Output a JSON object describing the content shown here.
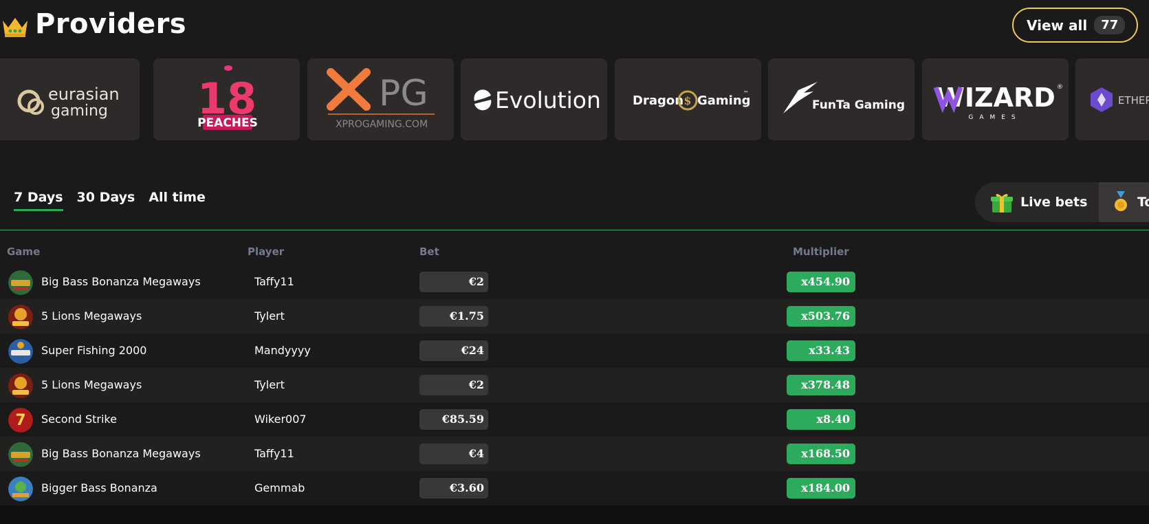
{
  "header": {
    "title": "Providers",
    "view_all_label": "View all",
    "view_all_count": "77",
    "crown_icon": "crown-icon"
  },
  "providers": [
    {
      "name": "eurasian gaming",
      "line1": "eurasian",
      "line2": "gaming"
    },
    {
      "name": "18 Peaches",
      "number": "18",
      "label": "PEACHES"
    },
    {
      "name": "XPG",
      "logo": "PG",
      "url": "XPROGAMING.COM"
    },
    {
      "name": "Evolution",
      "label": "Evolution"
    },
    {
      "name": "Dragon Gaming",
      "left": "Dragon",
      "right": "Gaming",
      "tm": "™"
    },
    {
      "name": "FunTa Gaming",
      "label": "FunTa Gaming"
    },
    {
      "name": "Wizard Games",
      "label": "WIZARD",
      "sub": "GAMES",
      "reg": "®"
    },
    {
      "name": "Ethereum",
      "label": "ETHER"
    }
  ],
  "tabs": [
    {
      "label": "7 Days",
      "active": true
    },
    {
      "label": "30 Days",
      "active": false
    },
    {
      "label": "All time",
      "active": false
    }
  ],
  "live_switch": {
    "live_label": "Live bets",
    "other_label": "To",
    "gift_icon": "gift-icon",
    "medal_icon": "medal-icon"
  },
  "table": {
    "headers": {
      "game": "Game",
      "player": "Player",
      "bet": "Bet",
      "multiplier": "Multiplier"
    },
    "rows": [
      {
        "game": "Big Bass Bonanza Megaways",
        "player": "Taffy11",
        "bet": "€2",
        "multiplier": "x454.90",
        "icon": "big-bass-icon"
      },
      {
        "game": "5 Lions Megaways",
        "player": "Tylert",
        "bet": "€1.75",
        "multiplier": "x503.76",
        "icon": "lions-icon"
      },
      {
        "game": "Super Fishing 2000",
        "player": "Mandyyyy",
        "bet": "€24",
        "multiplier": "x33.43",
        "icon": "fishing-icon"
      },
      {
        "game": "5 Lions Megaways",
        "player": "Tylert",
        "bet": "€2",
        "multiplier": "x378.48",
        "icon": "lions-icon"
      },
      {
        "game": "Second Strike",
        "player": "Wiker007",
        "bet": "€85.59",
        "multiplier": "x8.40",
        "icon": "seven-icon"
      },
      {
        "game": "Big Bass Bonanza Megaways",
        "player": "Taffy11",
        "bet": "€4",
        "multiplier": "x168.50",
        "icon": "big-bass-icon"
      },
      {
        "game": "Bigger Bass Bonanza",
        "player": "Gemmab",
        "bet": "€3.60",
        "multiplier": "x184.00",
        "icon": "bigger-bass-icon"
      }
    ]
  },
  "colors": {
    "background": "#1b1a1a",
    "card": "#2d2a29",
    "accent_green": "#2bab5b",
    "gold_border": "#f0c75a",
    "header_text": "#727a8c"
  }
}
